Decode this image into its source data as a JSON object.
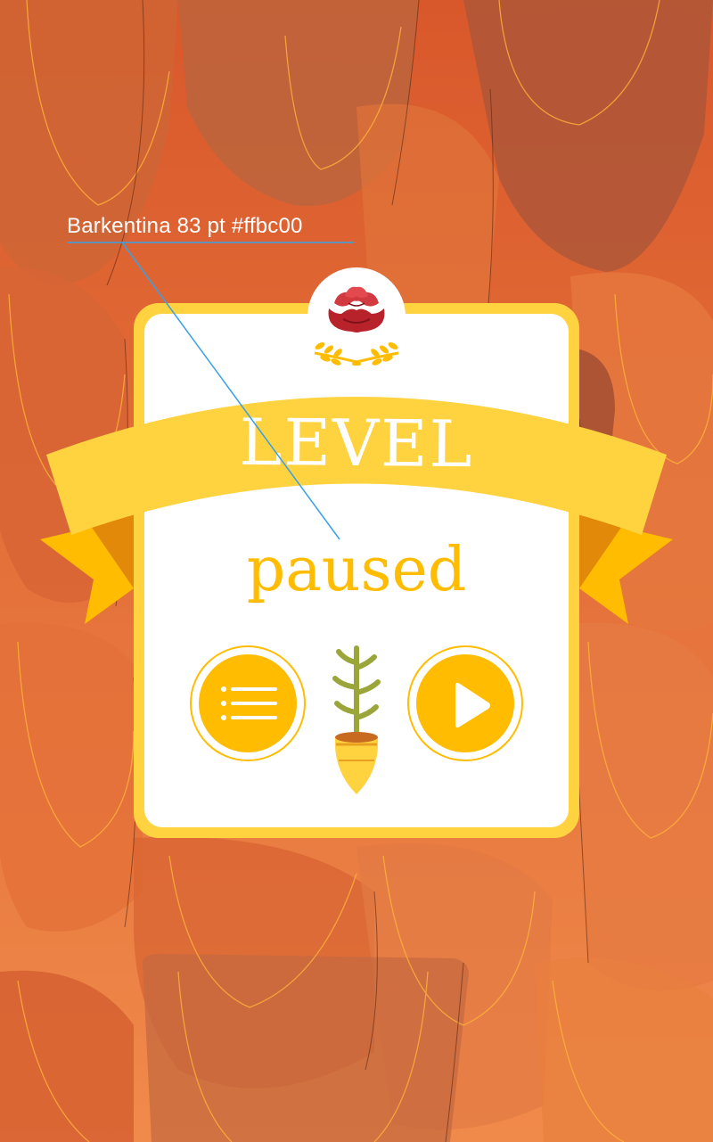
{
  "annotation": {
    "text": "Barkentina 83 pt #ffbc00",
    "line_color": "#3aa0e6"
  },
  "pause_screen": {
    "banner_title": "LEVEL",
    "subtitle": "paused",
    "menu_button_icon": "list-icon",
    "play_button_icon": "play-icon",
    "emblem_icon": "rose-icon",
    "decor_icon": "cactus-plant-icon"
  },
  "colors": {
    "accent": "#ffbc00",
    "panel_frame": "#ffd23f",
    "ribbon": "#ffd23f",
    "ribbon_tail": "#ffbc00",
    "background": "#e8703a",
    "rose": "#b8232b"
  }
}
